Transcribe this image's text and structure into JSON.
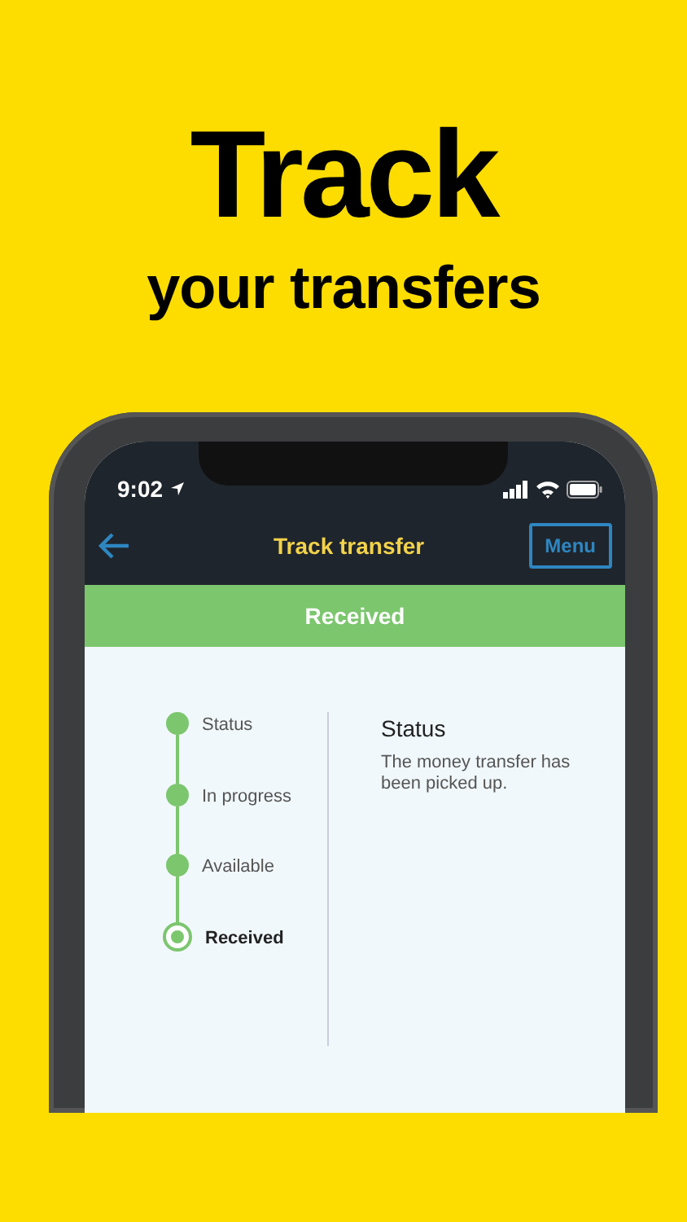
{
  "headline": {
    "title": "Track",
    "subtitle": "your transfers"
  },
  "status_bar": {
    "time": "9:02"
  },
  "header": {
    "title": "Track transfer",
    "menu": "Menu"
  },
  "banner": "Received",
  "steps": [
    {
      "label": "Status",
      "selected": false
    },
    {
      "label": "In progress",
      "selected": false
    },
    {
      "label": "Available",
      "selected": false
    },
    {
      "label": "Received",
      "selected": true
    }
  ],
  "detail": {
    "title": "Status",
    "text": "The money transfer has been picked up."
  }
}
